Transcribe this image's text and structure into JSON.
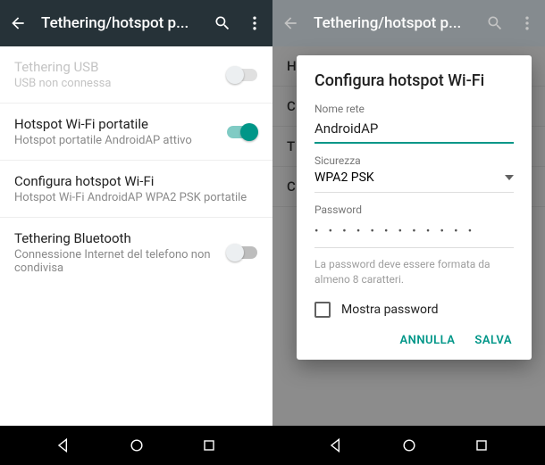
{
  "accent": "#009688",
  "toolbar": {
    "title": "Tethering/hotspot p..."
  },
  "left": {
    "items": [
      {
        "title": "Tethering USB",
        "subtitle": "USB non connessa",
        "disabled": true,
        "switch": "off"
      },
      {
        "title": "Hotspot Wi-Fi portatile",
        "subtitle": "Hotspot portatile AndroidAP attivo",
        "switch": "on"
      },
      {
        "title": "Configura hotspot Wi-Fi",
        "subtitle": "Hotspot Wi-Fi AndroidAP WPA2 PSK portatile",
        "switch": null
      },
      {
        "title": "Tethering Bluetooth",
        "subtitle": "Connessione Internet del telefono non condivisa",
        "switch": "off"
      }
    ]
  },
  "right": {
    "bg_rows": [
      "H",
      "C",
      "T",
      "C"
    ],
    "dialog": {
      "title": "Configura hotspot Wi-Fi",
      "network_label": "Nome rete",
      "network_value": "AndroidAP",
      "security_label": "Sicurezza",
      "security_value": "WPA2 PSK",
      "password_label": "Password",
      "password_masked": "• • • • • • • • • • • •",
      "hint": "La password deve essere formata da almeno 8 caratteri.",
      "show_password_label": "Mostra password",
      "cancel": "ANNULLA",
      "save": "SALVA"
    }
  }
}
